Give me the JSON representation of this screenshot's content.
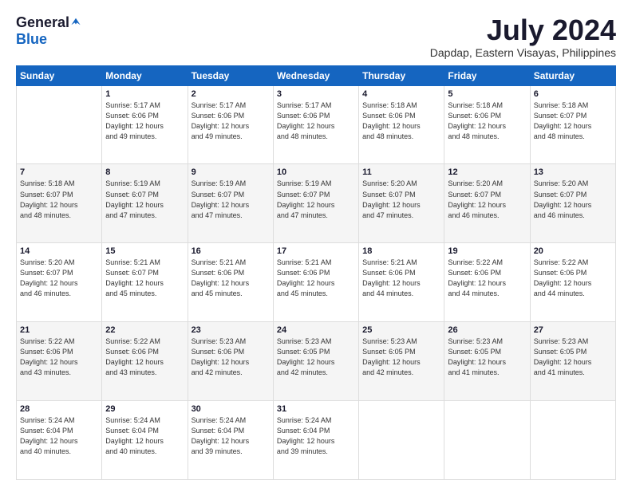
{
  "logo": {
    "general": "General",
    "blue": "Blue"
  },
  "header": {
    "title": "July 2024",
    "location": "Dapdap, Eastern Visayas, Philippines"
  },
  "weekdays": [
    "Sunday",
    "Monday",
    "Tuesday",
    "Wednesday",
    "Thursday",
    "Friday",
    "Saturday"
  ],
  "weeks": [
    [
      {
        "day": "",
        "info": ""
      },
      {
        "day": "1",
        "info": "Sunrise: 5:17 AM\nSunset: 6:06 PM\nDaylight: 12 hours\nand 49 minutes."
      },
      {
        "day": "2",
        "info": "Sunrise: 5:17 AM\nSunset: 6:06 PM\nDaylight: 12 hours\nand 49 minutes."
      },
      {
        "day": "3",
        "info": "Sunrise: 5:17 AM\nSunset: 6:06 PM\nDaylight: 12 hours\nand 48 minutes."
      },
      {
        "day": "4",
        "info": "Sunrise: 5:18 AM\nSunset: 6:06 PM\nDaylight: 12 hours\nand 48 minutes."
      },
      {
        "day": "5",
        "info": "Sunrise: 5:18 AM\nSunset: 6:06 PM\nDaylight: 12 hours\nand 48 minutes."
      },
      {
        "day": "6",
        "info": "Sunrise: 5:18 AM\nSunset: 6:07 PM\nDaylight: 12 hours\nand 48 minutes."
      }
    ],
    [
      {
        "day": "7",
        "info": "Sunrise: 5:18 AM\nSunset: 6:07 PM\nDaylight: 12 hours\nand 48 minutes."
      },
      {
        "day": "8",
        "info": "Sunrise: 5:19 AM\nSunset: 6:07 PM\nDaylight: 12 hours\nand 47 minutes."
      },
      {
        "day": "9",
        "info": "Sunrise: 5:19 AM\nSunset: 6:07 PM\nDaylight: 12 hours\nand 47 minutes."
      },
      {
        "day": "10",
        "info": "Sunrise: 5:19 AM\nSunset: 6:07 PM\nDaylight: 12 hours\nand 47 minutes."
      },
      {
        "day": "11",
        "info": "Sunrise: 5:20 AM\nSunset: 6:07 PM\nDaylight: 12 hours\nand 47 minutes."
      },
      {
        "day": "12",
        "info": "Sunrise: 5:20 AM\nSunset: 6:07 PM\nDaylight: 12 hours\nand 46 minutes."
      },
      {
        "day": "13",
        "info": "Sunrise: 5:20 AM\nSunset: 6:07 PM\nDaylight: 12 hours\nand 46 minutes."
      }
    ],
    [
      {
        "day": "14",
        "info": "Sunrise: 5:20 AM\nSunset: 6:07 PM\nDaylight: 12 hours\nand 46 minutes."
      },
      {
        "day": "15",
        "info": "Sunrise: 5:21 AM\nSunset: 6:07 PM\nDaylight: 12 hours\nand 45 minutes."
      },
      {
        "day": "16",
        "info": "Sunrise: 5:21 AM\nSunset: 6:06 PM\nDaylight: 12 hours\nand 45 minutes."
      },
      {
        "day": "17",
        "info": "Sunrise: 5:21 AM\nSunset: 6:06 PM\nDaylight: 12 hours\nand 45 minutes."
      },
      {
        "day": "18",
        "info": "Sunrise: 5:21 AM\nSunset: 6:06 PM\nDaylight: 12 hours\nand 44 minutes."
      },
      {
        "day": "19",
        "info": "Sunrise: 5:22 AM\nSunset: 6:06 PM\nDaylight: 12 hours\nand 44 minutes."
      },
      {
        "day": "20",
        "info": "Sunrise: 5:22 AM\nSunset: 6:06 PM\nDaylight: 12 hours\nand 44 minutes."
      }
    ],
    [
      {
        "day": "21",
        "info": "Sunrise: 5:22 AM\nSunset: 6:06 PM\nDaylight: 12 hours\nand 43 minutes."
      },
      {
        "day": "22",
        "info": "Sunrise: 5:22 AM\nSunset: 6:06 PM\nDaylight: 12 hours\nand 43 minutes."
      },
      {
        "day": "23",
        "info": "Sunrise: 5:23 AM\nSunset: 6:06 PM\nDaylight: 12 hours\nand 42 minutes."
      },
      {
        "day": "24",
        "info": "Sunrise: 5:23 AM\nSunset: 6:05 PM\nDaylight: 12 hours\nand 42 minutes."
      },
      {
        "day": "25",
        "info": "Sunrise: 5:23 AM\nSunset: 6:05 PM\nDaylight: 12 hours\nand 42 minutes."
      },
      {
        "day": "26",
        "info": "Sunrise: 5:23 AM\nSunset: 6:05 PM\nDaylight: 12 hours\nand 41 minutes."
      },
      {
        "day": "27",
        "info": "Sunrise: 5:23 AM\nSunset: 6:05 PM\nDaylight: 12 hours\nand 41 minutes."
      }
    ],
    [
      {
        "day": "28",
        "info": "Sunrise: 5:24 AM\nSunset: 6:04 PM\nDaylight: 12 hours\nand 40 minutes."
      },
      {
        "day": "29",
        "info": "Sunrise: 5:24 AM\nSunset: 6:04 PM\nDaylight: 12 hours\nand 40 minutes."
      },
      {
        "day": "30",
        "info": "Sunrise: 5:24 AM\nSunset: 6:04 PM\nDaylight: 12 hours\nand 39 minutes."
      },
      {
        "day": "31",
        "info": "Sunrise: 5:24 AM\nSunset: 6:04 PM\nDaylight: 12 hours\nand 39 minutes."
      },
      {
        "day": "",
        "info": ""
      },
      {
        "day": "",
        "info": ""
      },
      {
        "day": "",
        "info": ""
      }
    ]
  ]
}
